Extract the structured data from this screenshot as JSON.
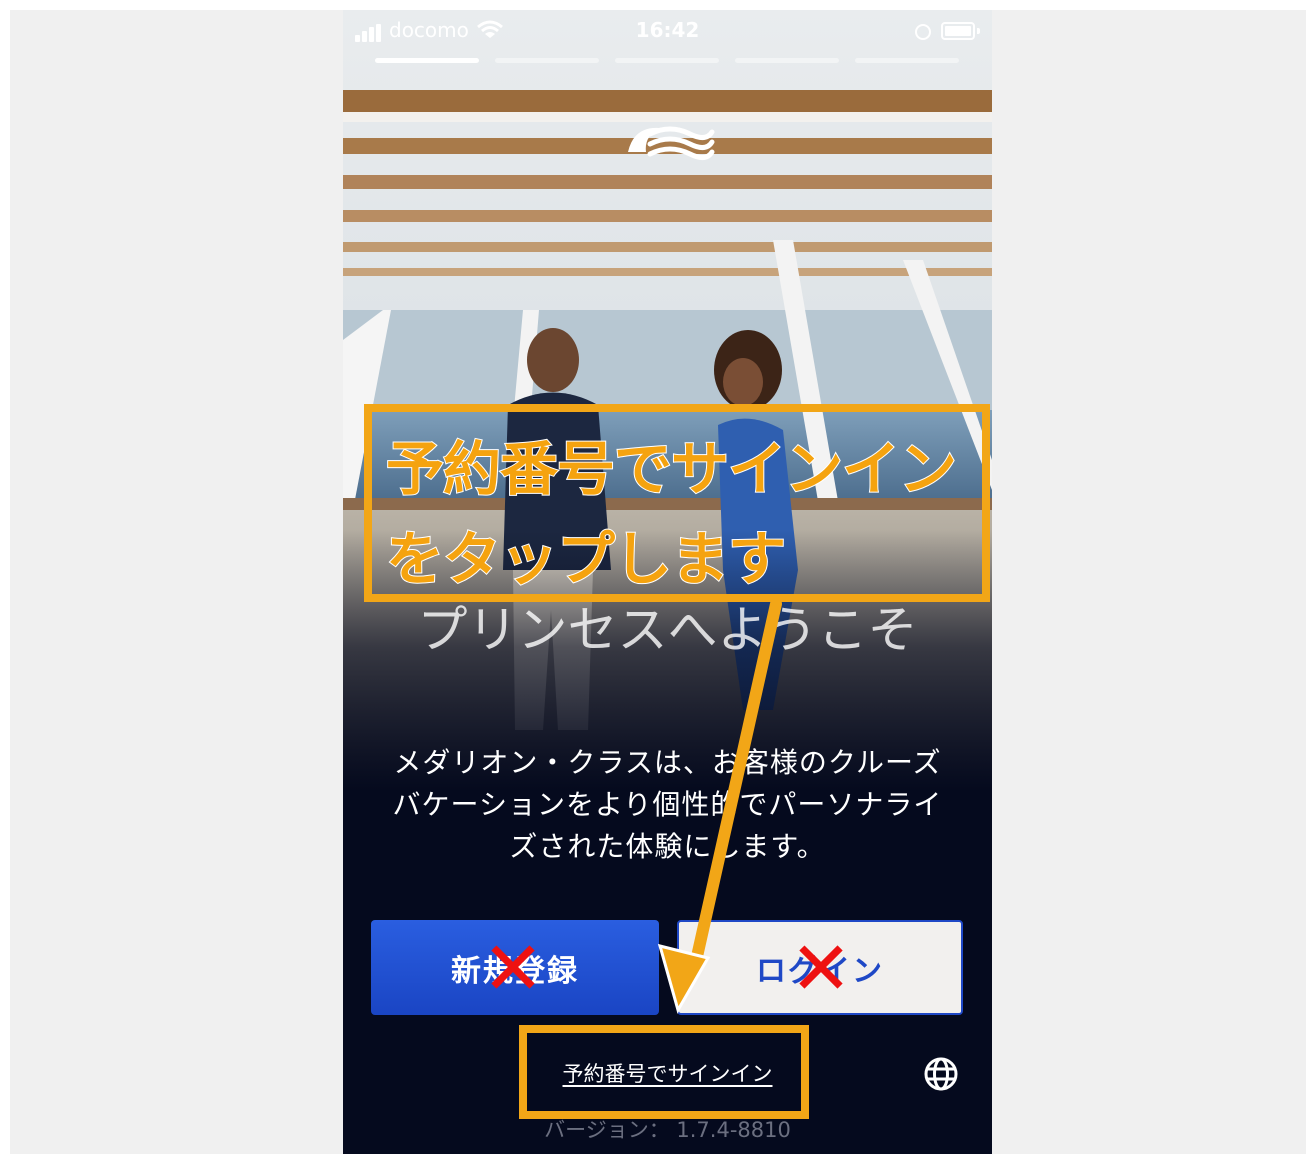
{
  "status_bar": {
    "carrier": "docomo",
    "time": "16:42"
  },
  "progress": {
    "total_segments": 5,
    "active_segment": 1
  },
  "welcome": {
    "title": "プリンセスへようこそ",
    "description": "メダリオン・クラスは、お客様のクルーズバケーションをより個性的でパーソナライズされた体験にします。"
  },
  "buttons": {
    "register_label": "新規登録",
    "login_label": "ログイン"
  },
  "signin_link": "予約番号でサインイン",
  "version": "バージョン： 1.7.4-8810",
  "annotation": {
    "line1": "予約番号でサインイン",
    "line2": "をタップします",
    "color": "#f2a617"
  },
  "icons": {
    "logo": "princess-seawitch-logo-icon",
    "globe": "globe-icon",
    "cross": "red-x-mark-icon"
  }
}
